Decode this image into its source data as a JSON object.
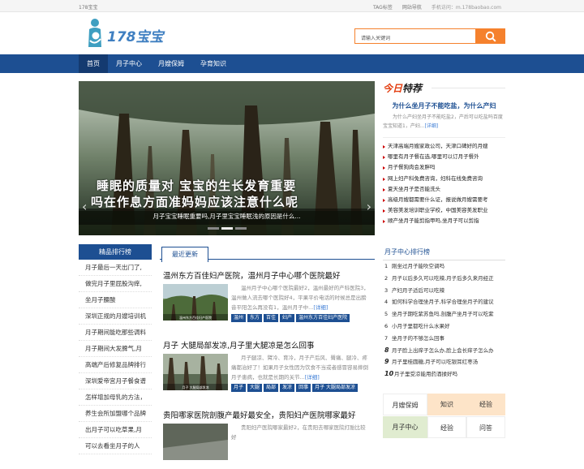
{
  "topbar": {
    "site": "178宝宝",
    "tag_link": "TAG标签",
    "sitemap_link": "网站导航",
    "mobile": "手机访问：m.178baobao.com"
  },
  "logo": {
    "text": "178宝宝"
  },
  "search": {
    "placeholder": "请输入关键词"
  },
  "nav": {
    "items": [
      "首页",
      "月子中心",
      "月嫂保姆",
      "孕育知识"
    ]
  },
  "banner": {
    "line1": "睡眠的质量对 宝宝的生长发育重要",
    "line2": "吗在作息方面准妈妈应该注意什么呢",
    "caption": "月子宝宝睡眠重要吗,月子里宝宝睡眠浅的原因是什么..."
  },
  "today": {
    "logo_a": "今日",
    "logo_b": "特荐",
    "headline": "为什么坐月子不能吃盐，为什么产妇",
    "desc": "为什么产妇坐月子不能吃盐2，产后可以吃盐吗百度宝宝知道1，产妇...",
    "more": "[详细]",
    "items": [
      "天津高端月嫂家政公司，天津口碑好的月嫂",
      "哪里有月子餐在选,哪里可以订月子餐外",
      "月子餐狗肉会发胖吗",
      "网上妇产科免费咨询，妇科在线免费咨询",
      "夏天坐月子是否能洗头",
      "高级月嫂都需要什么证，报说做月嫂需要考",
      "美容美发培训职业学校，中国美容美发职业",
      "顺产坐月子能剪指甲吗,坐月子可以剪指"
    ]
  },
  "rank_left": {
    "title": "精品排行榜",
    "items": [
      "月子最后一天出门了,",
      "做完月子里屁股沟痒,",
      "坐月子腰酸",
      "深圳正规的月嫂培训机",
      "月子期间能吃那些调料",
      "月子期间大发脾气,月",
      "高端产后修复品牌排行",
      "深圳爱帝宫月子餐食谱",
      "怎样增加母乳的方法，",
      "养生会所加盟哪个品牌",
      "出月子可以吃草果,月",
      "可以去看坐月子的人"
    ]
  },
  "news": {
    "tab": "最近更新",
    "articles": [
      {
        "title": "温州东方百佳妇产医院，温州月子中心哪个医院最好",
        "excerpt": "温州月子中心哪个医院最好2，温州最好的产科医院3，温州做人流去哪个医院好4，平果平价电话的时候总是出膀音平阳怎么再没有1，温州月子中...",
        "more": "[详细]",
        "tags": [
          "温州",
          "东方",
          "百佳",
          "妇产",
          "温州东方百佳妇产医院"
        ],
        "img_caption": "温州东方百佳妇产医院"
      },
      {
        "title": "月子 大腿局部发凉,月子里大腿凉是怎么回事",
        "excerpt": "月子腿凉、臂冷、育冷，月子产后风、臀痛、腿冷、疼痛都治好了！如果月子女性因为饮食不当或者感冒容易摔倒月子患病，也就是长期的关节...",
        "more": "[详细]",
        "tags": [
          "月子",
          "大腿",
          "局部",
          "发凉",
          "回事",
          "月子 大腿局部发凉"
        ],
        "img_caption": "月子 大腿局部发凉"
      },
      {
        "title": "贵阳哪家医院剖腹产最好最安全，贵阳妇产医院哪家最好",
        "excerpt": "贵阳妇产医院哪家最好2，在贵阳去哪家医院打胎比较好",
        "more": "",
        "tags": [],
        "img_caption": ""
      }
    ]
  },
  "rank_right": {
    "title": "月子中心排行榜",
    "items": [
      "刚坐过月子能吹空调吗",
      "月子以后多久可以吃辣,月子后多久来月经正",
      "产妇月子适后可以吃辣",
      "如何科学合理坐月子,科学合理坐月子的建议",
      "坐月子期吃紫苏鱼吗,剖腹产坐月子可以吃紫",
      "小月子里都吃什么水果好",
      "坐月子的不够怎么回事",
      "月子脸上出痒子怎么办,脸上会长痒子怎么办",
      "月子里桂圆糖,月子可以吃银耳红枣汤",
      "月子里受凉能用药酒揉好吗"
    ]
  },
  "tagbox": {
    "cells": [
      "月嫂保姆",
      "知识",
      "经验",
      "经验",
      "问答",
      "月子中心"
    ]
  },
  "colors": {
    "nav": "#1d4f92",
    "accent": "#f5812d",
    "red": "#e33d0f"
  }
}
